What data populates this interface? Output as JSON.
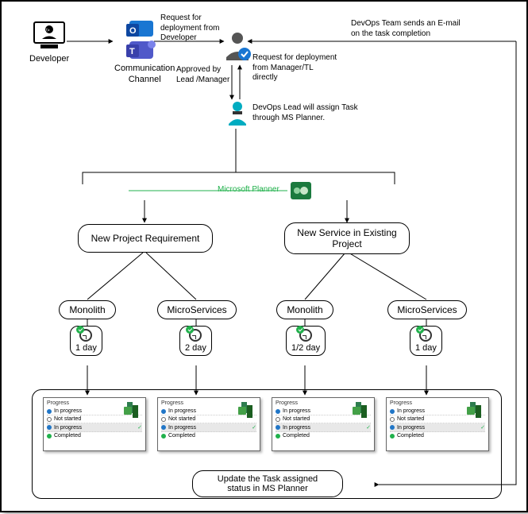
{
  "actors": {
    "developer": "Developer",
    "commchannel": "Communication\nChannel"
  },
  "labels": {
    "req_dev": "Request for\ndeployment from\nDeveloper",
    "approved": "Approved by\nLead /Manager",
    "req_mgr": "Request for deployment\nfrom Manager/TL\ndirectly",
    "lead_assign": "DevOps Lead will assign Task\nthrough MS Planner.",
    "email": "DevOps Team sends an E-mail\non the task completion",
    "msplanner": "Microsoft Planner"
  },
  "nodes": {
    "new_project": "New Project Requirement",
    "new_service": "New Service in Existing\nProject",
    "monolith": "Monolith",
    "microservices": "MicroServices",
    "update_status": "Update the Task assigned\nstatus in MS Planner"
  },
  "durations": {
    "d1": "1 day",
    "d2": "2 day",
    "d3": "1/2 day",
    "d4": "1 day"
  },
  "progress": {
    "title": "Progress",
    "in_progress": "In progress",
    "not_started": "Not started",
    "completed": "Completed"
  }
}
